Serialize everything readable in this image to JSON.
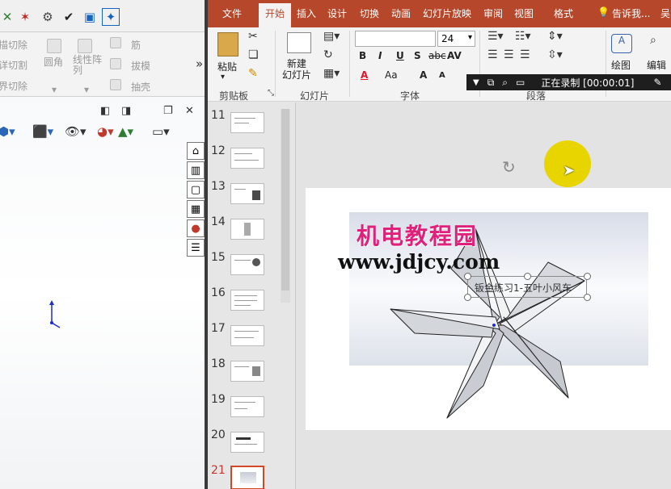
{
  "solidworks": {
    "ribbon_items": [
      "描切除",
      "详切割",
      "界切除",
      "圆角",
      "线性阵列",
      "筋",
      "拔模",
      "抽壳"
    ],
    "more_chevron": "»",
    "panel_buttons": [
      "◧",
      "◨",
      "❐",
      "✕"
    ],
    "task_pane_icons": [
      "home-icon",
      "parts-icon",
      "folder-icon",
      "appearance-icon",
      "color-icon",
      "properties-icon"
    ]
  },
  "powerpoint": {
    "tabs": [
      "文件",
      "开始",
      "插入",
      "设计",
      "切换",
      "动画",
      "幻灯片放映",
      "审阅",
      "视图",
      "格式"
    ],
    "active_tab": "开始",
    "tell_me": "告诉我...",
    "user_initial": "吴",
    "groups": [
      "剪贴板",
      "幻灯片",
      "字体",
      "段落"
    ],
    "buttons": {
      "paste": "粘贴",
      "new_slide": "新建\n幻灯片",
      "drawing": "绘图",
      "editing": "编辑"
    },
    "font": {
      "name": "",
      "size": "24"
    },
    "font_buttons": [
      "B",
      "I",
      "U",
      "S",
      "abc",
      "AV",
      "A",
      "Aa",
      "A",
      "A"
    ],
    "recording": {
      "status": "正在录制 [00:00:01]"
    },
    "thumbnails": [
      "11",
      "12",
      "13",
      "14",
      "15",
      "16",
      "17",
      "18",
      "19",
      "20",
      "21"
    ],
    "selected_slide": "21",
    "slide": {
      "textbox": "钣金练习1-五叶小风车",
      "watermark_cn": "机电教程园",
      "watermark_url": "www.jdjcy.com"
    },
    "colors": {
      "accent": "#b7472a",
      "font_color": "#e81123",
      "pointer": "#e8d500"
    }
  }
}
